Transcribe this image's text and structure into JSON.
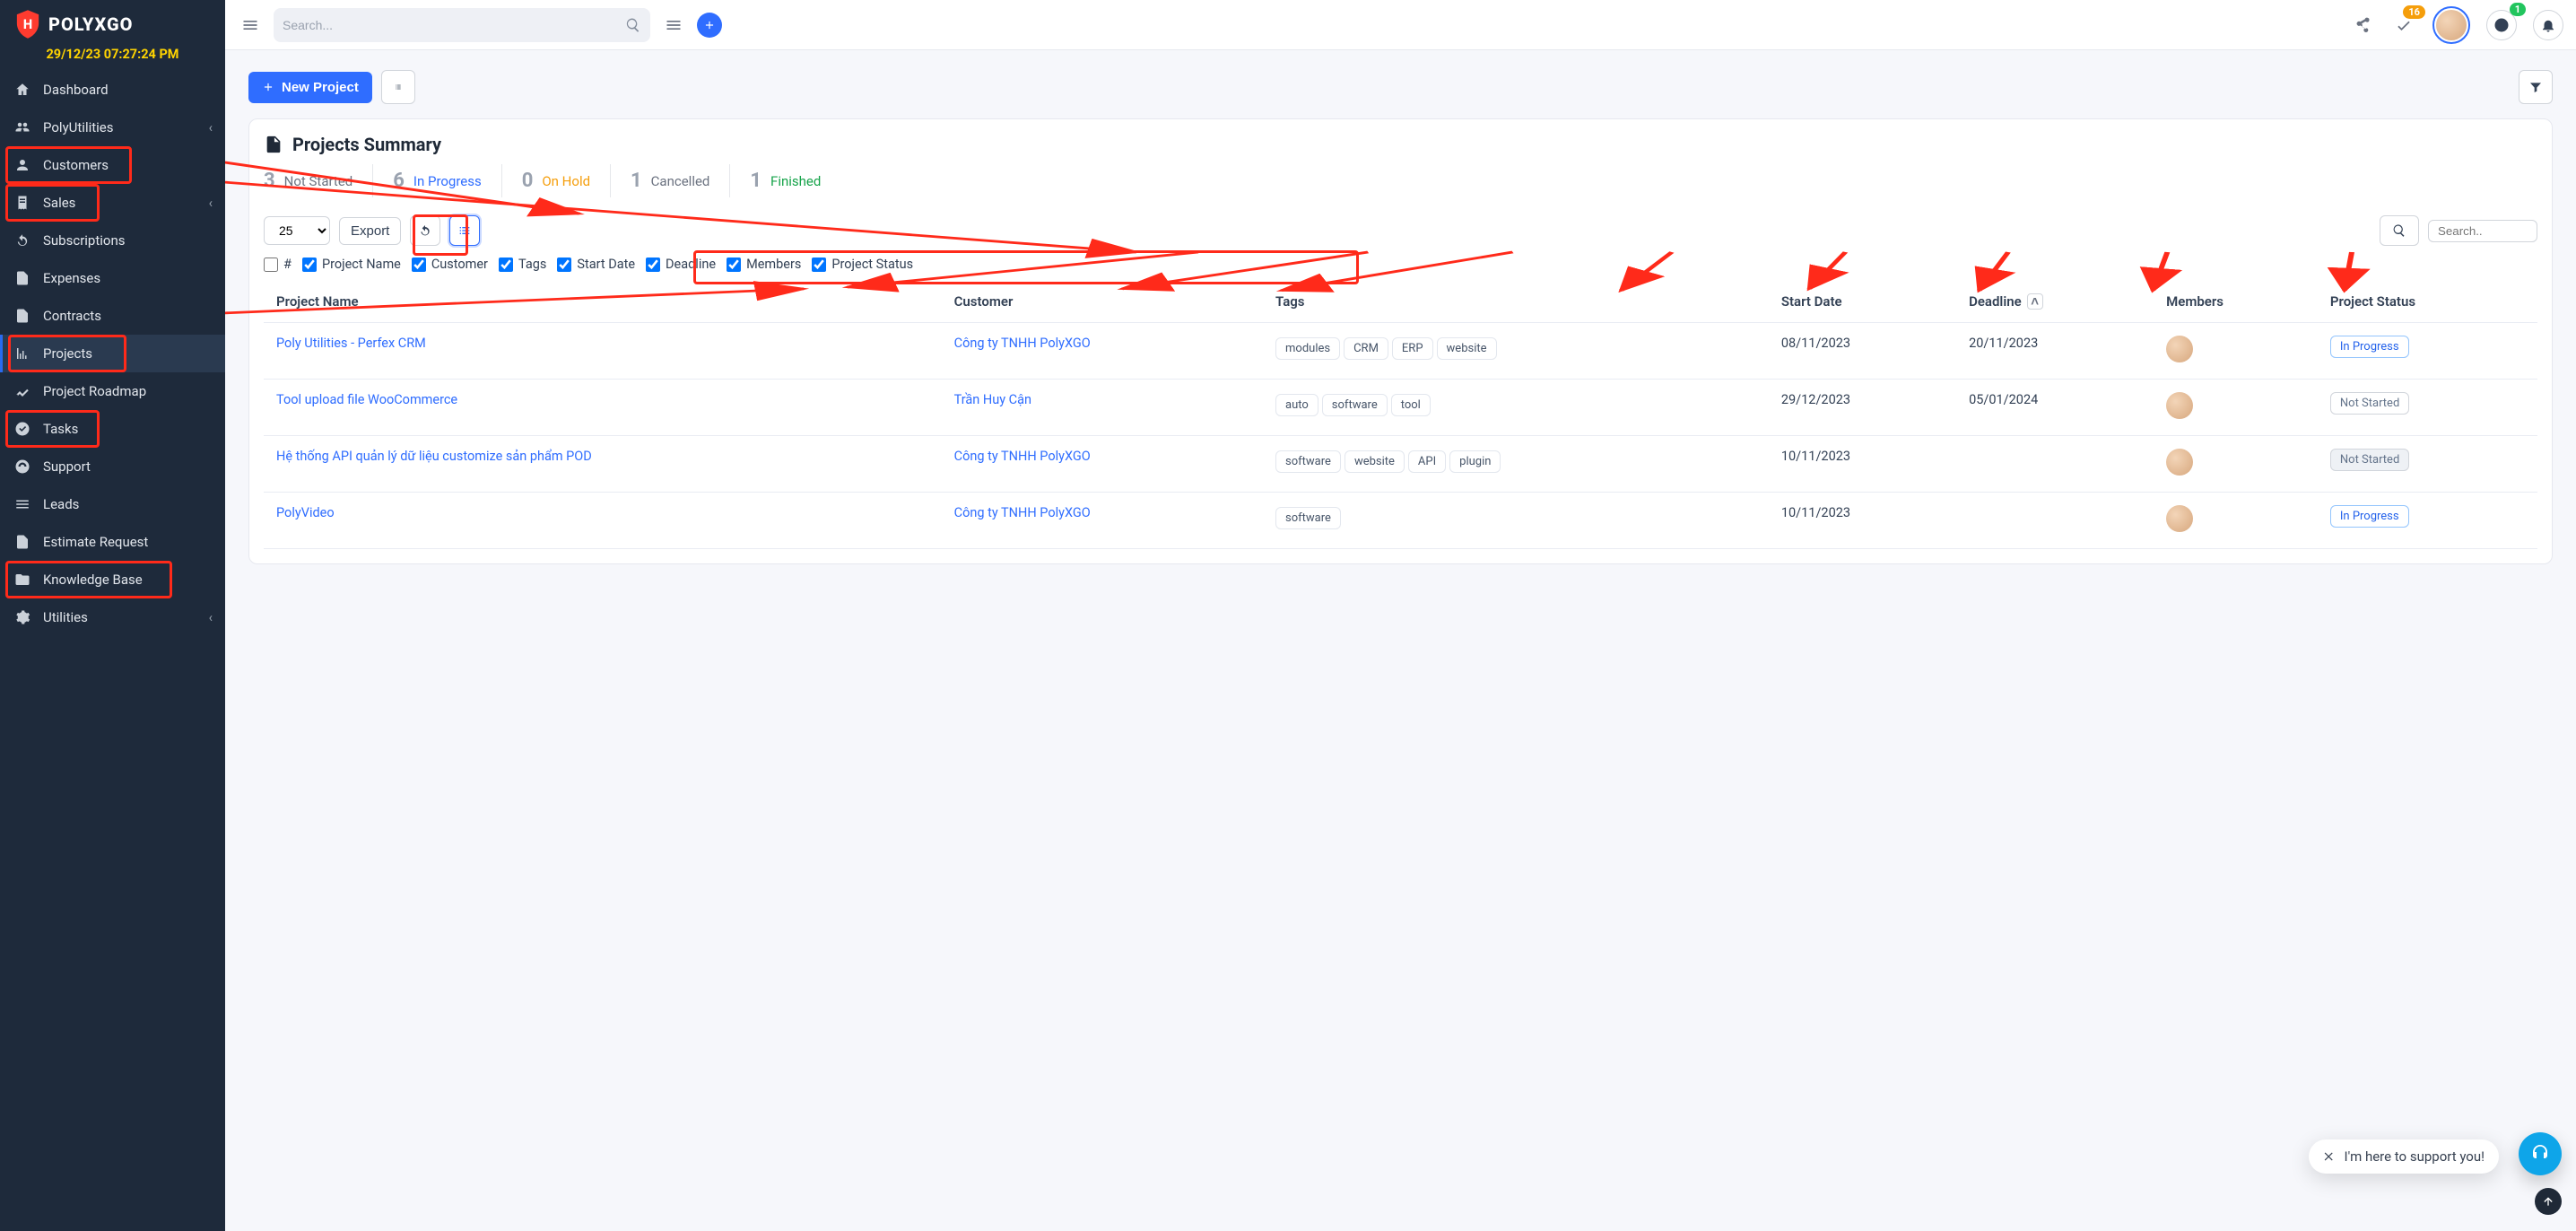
{
  "brand": "POLYXGO",
  "clock": "29/12/23 07:27:24 PM",
  "sidebar": {
    "items": [
      {
        "label": "Dashboard"
      },
      {
        "label": "PolyUtilities",
        "has_children": true
      },
      {
        "label": "Customers"
      },
      {
        "label": "Sales",
        "has_children": true
      },
      {
        "label": "Subscriptions"
      },
      {
        "label": "Expenses"
      },
      {
        "label": "Contracts"
      },
      {
        "label": "Projects",
        "active": true
      },
      {
        "label": "Project Roadmap"
      },
      {
        "label": "Tasks"
      },
      {
        "label": "Support"
      },
      {
        "label": "Leads"
      },
      {
        "label": "Estimate Request"
      },
      {
        "label": "Knowledge Base"
      },
      {
        "label": "Utilities",
        "has_children": true
      }
    ]
  },
  "topbar": {
    "search_placeholder": "Search...",
    "badges": {
      "check": "16",
      "clock": "1"
    }
  },
  "actions": {
    "new_project": "New Project"
  },
  "summary": {
    "title": "Projects Summary",
    "stats": [
      {
        "num": "3",
        "label": "Not Started",
        "cls": "grey"
      },
      {
        "num": "6",
        "label": "In Progress",
        "cls": "blue"
      },
      {
        "num": "0",
        "label": "On Hold",
        "cls": "orange"
      },
      {
        "num": "1",
        "label": "Cancelled",
        "cls": "grey"
      },
      {
        "num": "1",
        "label": "Finished",
        "cls": "green"
      }
    ]
  },
  "tools": {
    "page_size": "25",
    "export": "Export",
    "search_placeholder": "Search.."
  },
  "columns": {
    "toggles": [
      {
        "label": "#",
        "checked": false
      },
      {
        "label": "Project Name",
        "checked": true
      },
      {
        "label": "Customer",
        "checked": true
      },
      {
        "label": "Tags",
        "checked": true
      },
      {
        "label": "Start Date",
        "checked": true
      },
      {
        "label": "Deadline",
        "checked": true
      },
      {
        "label": "Members",
        "checked": true
      },
      {
        "label": "Project Status",
        "checked": true
      }
    ]
  },
  "table": {
    "headers": [
      "Project Name",
      "Customer",
      "Tags",
      "Start Date",
      "Deadline",
      "Members",
      "Project Status"
    ],
    "sort": {
      "col_index": 4,
      "dir": "asc"
    },
    "rows": [
      {
        "name": "Poly Utilities - Perfex CRM",
        "customer": "Công ty TNHH PolyXGO",
        "tags": [
          "modules",
          "CRM",
          "ERP",
          "website"
        ],
        "start": "08/11/2023",
        "deadline": "20/11/2023",
        "status": "In Progress",
        "status_cls": "blue"
      },
      {
        "name": "Tool upload file WooCommerce",
        "customer": "Trần Huy Cận",
        "tags": [
          "auto",
          "software",
          "tool"
        ],
        "start": "29/12/2023",
        "deadline": "05/01/2024",
        "status": "Not Started",
        "status_cls": ""
      },
      {
        "name": "Hệ thống API quản lý dữ liệu customize sản phẩm POD",
        "customer": "Công ty TNHH PolyXGO",
        "tags": [
          "software",
          "website",
          "API",
          "plugin"
        ],
        "start": "10/11/2023",
        "deadline": "",
        "status": "Not Started",
        "status_cls": "muted"
      },
      {
        "name": "PolyVideo",
        "customer": "Công ty TNHH PolyXGO",
        "tags": [
          "software"
        ],
        "start": "10/11/2023",
        "deadline": "",
        "status": "In Progress",
        "status_cls": "blue"
      }
    ]
  },
  "support_bubble": {
    "text": "I'm here to support you!"
  }
}
